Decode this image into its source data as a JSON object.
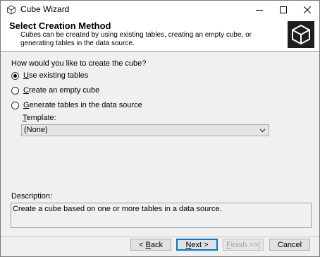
{
  "window": {
    "title": "Cube Wizard"
  },
  "header": {
    "title": "Select Creation Method",
    "description": "Cubes can be created by using existing tables, creating an empty cube, or generating tables in the data source."
  },
  "question": "How would you like to create the cube?",
  "options": [
    {
      "label_u": "U",
      "label_rest": "se existing tables",
      "checked": true
    },
    {
      "label_u": "C",
      "label_rest": "reate an empty cube",
      "checked": false
    },
    {
      "label_u": "G",
      "label_rest": "enerate tables in the data source",
      "checked": false
    }
  ],
  "template": {
    "label_u": "T",
    "label_rest": "emplate:",
    "selected": "(None)"
  },
  "description": {
    "label": "Description:",
    "text": "Create a cube based on one or more tables in a data source."
  },
  "buttons": {
    "back": {
      "pre": "< ",
      "u": "B",
      "rest": "ack"
    },
    "next": {
      "u": "N",
      "rest": "ext >"
    },
    "finish": {
      "u": "F",
      "rest": "inish >>|"
    },
    "cancel": "Cancel"
  },
  "colors": {
    "header_bg": "#ffffff",
    "body_bg": "#f0f0f0",
    "default_button_border": "#0078d7"
  }
}
